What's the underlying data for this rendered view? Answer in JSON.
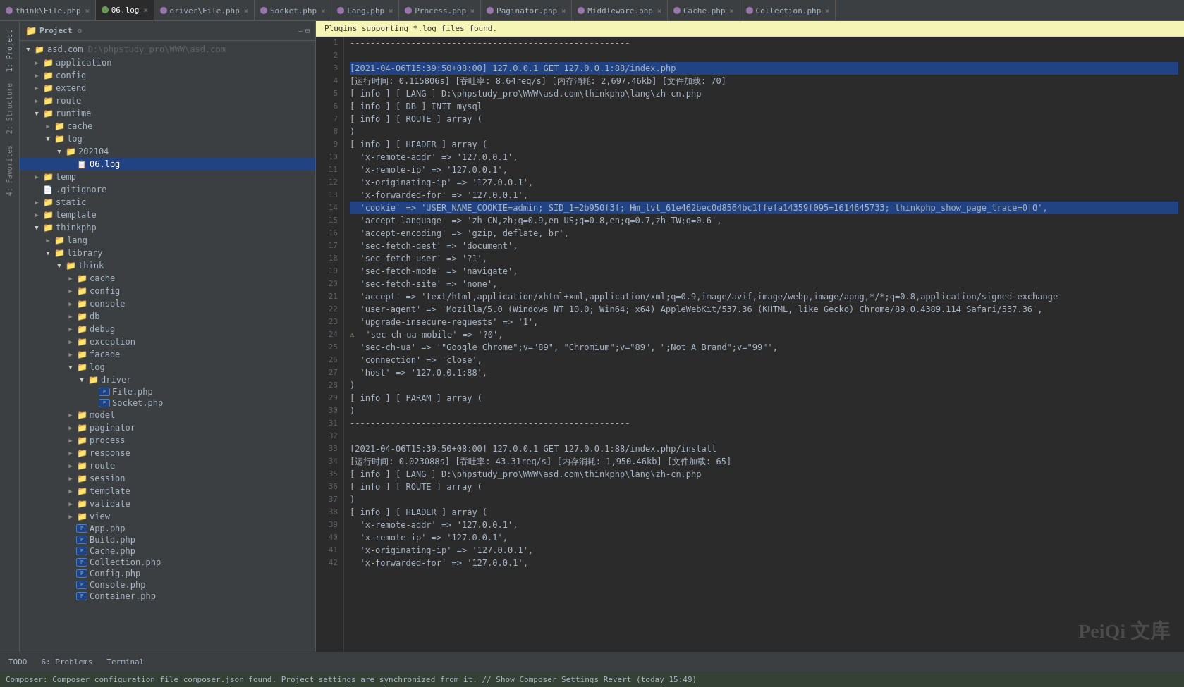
{
  "tabs": [
    {
      "id": "think-file",
      "label": "think\\File.php",
      "icon_color": "#9876aa",
      "active": false,
      "closeable": true
    },
    {
      "id": "06-log",
      "label": "06.log",
      "icon_color": "#6a9955",
      "active": true,
      "closeable": true
    },
    {
      "id": "driver-file",
      "label": "driver\\File.php",
      "icon_color": "#9876aa",
      "active": false,
      "closeable": true
    },
    {
      "id": "socket",
      "label": "Socket.php",
      "icon_color": "#9876aa",
      "active": false,
      "closeable": true
    },
    {
      "id": "lang",
      "label": "Lang.php",
      "icon_color": "#9876aa",
      "active": false,
      "closeable": true
    },
    {
      "id": "process",
      "label": "Process.php",
      "icon_color": "#9876aa",
      "active": false,
      "closeable": true
    },
    {
      "id": "paginator",
      "label": "Paginator.php",
      "icon_color": "#9876aa",
      "active": false,
      "closeable": true
    },
    {
      "id": "middleware",
      "label": "Middleware.php",
      "icon_color": "#9876aa",
      "active": false,
      "closeable": true
    },
    {
      "id": "cache",
      "label": "Cache.php",
      "icon_color": "#9876aa",
      "active": false,
      "closeable": true
    },
    {
      "id": "collection",
      "label": "Collection.php",
      "icon_color": "#9876aa",
      "active": false,
      "closeable": true
    }
  ],
  "notification": "Plugins supporting *.log files found.",
  "sidebar": {
    "title": "Project",
    "root": "asd.com",
    "root_path": "D:\\phpstudy_pro\\WWW\\asd.com",
    "items": [
      {
        "label": "application",
        "type": "folder",
        "depth": 1,
        "open": false
      },
      {
        "label": "config",
        "type": "folder",
        "depth": 1,
        "open": false
      },
      {
        "label": "extend",
        "type": "folder",
        "depth": 1,
        "open": false
      },
      {
        "label": "route",
        "type": "folder",
        "depth": 1,
        "open": false
      },
      {
        "label": "runtime",
        "type": "folder",
        "depth": 1,
        "open": true
      },
      {
        "label": "cache",
        "type": "folder",
        "depth": 2,
        "open": false
      },
      {
        "label": "log",
        "type": "folder",
        "depth": 2,
        "open": true
      },
      {
        "label": "202104",
        "type": "folder",
        "depth": 3,
        "open": true
      },
      {
        "label": "06.log",
        "type": "file-log",
        "depth": 4,
        "open": false,
        "selected": true
      },
      {
        "label": "temp",
        "type": "folder",
        "depth": 1,
        "open": false
      },
      {
        "label": ".gitignore",
        "type": "file",
        "depth": 1,
        "open": false
      },
      {
        "label": "static",
        "type": "folder",
        "depth": 1,
        "open": false
      },
      {
        "label": "template",
        "type": "folder",
        "depth": 1,
        "open": false
      },
      {
        "label": "thinkphp",
        "type": "folder",
        "depth": 1,
        "open": true
      },
      {
        "label": "lang",
        "type": "folder",
        "depth": 2,
        "open": false
      },
      {
        "label": "library",
        "type": "folder",
        "depth": 2,
        "open": true
      },
      {
        "label": "think",
        "type": "folder",
        "depth": 3,
        "open": true
      },
      {
        "label": "cache",
        "type": "folder",
        "depth": 4,
        "open": false
      },
      {
        "label": "config",
        "type": "folder",
        "depth": 4,
        "open": false
      },
      {
        "label": "console",
        "type": "folder",
        "depth": 4,
        "open": false
      },
      {
        "label": "db",
        "type": "folder",
        "depth": 4,
        "open": false
      },
      {
        "label": "debug",
        "type": "folder",
        "depth": 4,
        "open": false
      },
      {
        "label": "exception",
        "type": "folder",
        "depth": 4,
        "open": false
      },
      {
        "label": "facade",
        "type": "folder",
        "depth": 4,
        "open": false
      },
      {
        "label": "log",
        "type": "folder",
        "depth": 4,
        "open": true
      },
      {
        "label": "driver",
        "type": "folder",
        "depth": 5,
        "open": true
      },
      {
        "label": "File.php",
        "type": "file-php",
        "depth": 6,
        "open": false
      },
      {
        "label": "Socket.php",
        "type": "file-php",
        "depth": 6,
        "open": false
      },
      {
        "label": "model",
        "type": "folder",
        "depth": 4,
        "open": false
      },
      {
        "label": "paginator",
        "type": "folder",
        "depth": 4,
        "open": false
      },
      {
        "label": "process",
        "type": "folder",
        "depth": 4,
        "open": false
      },
      {
        "label": "response",
        "type": "folder",
        "depth": 4,
        "open": false
      },
      {
        "label": "route",
        "type": "folder",
        "depth": 4,
        "open": false
      },
      {
        "label": "session",
        "type": "folder",
        "depth": 4,
        "open": false
      },
      {
        "label": "template",
        "type": "folder",
        "depth": 4,
        "open": false
      },
      {
        "label": "validate",
        "type": "folder",
        "depth": 4,
        "open": false
      },
      {
        "label": "view",
        "type": "folder",
        "depth": 4,
        "open": false
      },
      {
        "label": "App.php",
        "type": "file-php",
        "depth": 4,
        "open": false
      },
      {
        "label": "Build.php",
        "type": "file-php",
        "depth": 4,
        "open": false
      },
      {
        "label": "Cache.php",
        "type": "file-php",
        "depth": 4,
        "open": false
      },
      {
        "label": "Collection.php",
        "type": "file-php",
        "depth": 4,
        "open": false
      },
      {
        "label": "Config.php",
        "type": "file-php",
        "depth": 4,
        "open": false
      },
      {
        "label": "Console.php",
        "type": "file-php",
        "depth": 4,
        "open": false
      },
      {
        "label": "Container.php",
        "type": "file-php",
        "depth": 4,
        "open": false
      }
    ]
  },
  "left_tabs": [
    {
      "label": "1: Project",
      "active": true
    },
    {
      "label": "2: Structure",
      "active": false
    },
    {
      "label": "4: Favorites",
      "active": false
    }
  ],
  "code_lines": [
    {
      "num": 1,
      "text": "-------------------------------------------------------",
      "highlighted": false
    },
    {
      "num": 2,
      "text": "",
      "highlighted": false
    },
    {
      "num": 3,
      "text": "[2021-04-06T15:39:50+08:00] 127.0.0.1 GET 127.0.0.1:88/index.php",
      "highlighted": true
    },
    {
      "num": 4,
      "text": "[运行时间: 0.115806s] [吞吐率: 8.64req/s] [内存消耗: 2,697.46kb] [文件加载: 70]",
      "highlighted": false
    },
    {
      "num": 5,
      "text": "[ info ] [ LANG ] D:\\phpstudy_pro\\WWW\\asd.com\\thinkphp\\lang\\zh-cn.php",
      "highlighted": false
    },
    {
      "num": 6,
      "text": "[ info ] [ DB ] INIT mysql",
      "highlighted": false
    },
    {
      "num": 7,
      "text": "[ info ] [ ROUTE ] array (",
      "highlighted": false
    },
    {
      "num": 8,
      "text": ")",
      "highlighted": false
    },
    {
      "num": 9,
      "text": "[ info ] [ HEADER ] array (",
      "highlighted": false
    },
    {
      "num": 10,
      "text": "  'x-remote-addr' => '127.0.0.1',",
      "highlighted": false
    },
    {
      "num": 11,
      "text": "  'x-remote-ip' => '127.0.0.1',",
      "highlighted": false
    },
    {
      "num": 12,
      "text": "  'x-originating-ip' => '127.0.0.1',",
      "highlighted": false
    },
    {
      "num": 13,
      "text": "  'x-forwarded-for' => '127.0.0.1',",
      "highlighted": false
    },
    {
      "num": 14,
      "text": "  'cookie' => 'USER_NAME_COOKIE=admin; SID_1=2b950f3f; Hm_lvt_61e462bec0d8564bc1ffefa14359f095=1614645733; thinkphp_show_page_trace=0|0',",
      "highlighted": true
    },
    {
      "num": 15,
      "text": "  'accept-language' => 'zh-CN,zh;q=0.9,en-US;q=0.8,en;q=0.7,zh-TW;q=0.6',",
      "highlighted": false
    },
    {
      "num": 16,
      "text": "  'accept-encoding' => 'gzip, deflate, br',",
      "highlighted": false
    },
    {
      "num": 17,
      "text": "  'sec-fetch-dest' => 'document',",
      "highlighted": false
    },
    {
      "num": 18,
      "text": "  'sec-fetch-user' => '?1',",
      "highlighted": false
    },
    {
      "num": 19,
      "text": "  'sec-fetch-mode' => 'navigate',",
      "highlighted": false
    },
    {
      "num": 20,
      "text": "  'sec-fetch-site' => 'none',",
      "highlighted": false
    },
    {
      "num": 21,
      "text": "  'accept' => 'text/html,application/xhtml+xml,application/xml;q=0.9,image/avif,image/webp,image/apng,*/*;q=0.8,application/signed-exchange",
      "highlighted": false
    },
    {
      "num": 22,
      "text": "  'user-agent' => 'Mozilla/5.0 (Windows NT 10.0; Win64; x64) AppleWebKit/537.36 (KHTML, like Gecko) Chrome/89.0.4389.114 Safari/537.36',",
      "highlighted": false
    },
    {
      "num": 23,
      "text": "  'upgrade-insecure-requests' => '1',",
      "highlighted": false
    },
    {
      "num": 24,
      "text": "  'sec-ch-ua-mobile' => '?0',",
      "highlighted": false,
      "has_dot": true
    },
    {
      "num": 25,
      "text": "  'sec-ch-ua' => '\"Google Chrome\";v=\"89\", \"Chromium\";v=\"89\", \";Not A Brand\";v=\"99\"',",
      "highlighted": false
    },
    {
      "num": 26,
      "text": "  'connection' => 'close',",
      "highlighted": false
    },
    {
      "num": 27,
      "text": "  'host' => '127.0.0.1:88',",
      "highlighted": false
    },
    {
      "num": 28,
      "text": ")",
      "highlighted": false
    },
    {
      "num": 29,
      "text": "[ info ] [ PARAM ] array (",
      "highlighted": false
    },
    {
      "num": 30,
      "text": ")",
      "highlighted": false
    },
    {
      "num": 31,
      "text": "-------------------------------------------------------",
      "highlighted": false
    },
    {
      "num": 32,
      "text": "",
      "highlighted": false
    },
    {
      "num": 33,
      "text": "[2021-04-06T15:39:50+08:00] 127.0.0.1 GET 127.0.0.1:88/index.php/install",
      "highlighted": false
    },
    {
      "num": 34,
      "text": "[运行时间: 0.023088s] [吞吐率: 43.31req/s] [内存消耗: 1,950.46kb] [文件加载: 65]",
      "highlighted": false
    },
    {
      "num": 35,
      "text": "[ info ] [ LANG ] D:\\phpstudy_pro\\WWW\\asd.com\\thinkphp\\lang\\zh-cn.php",
      "highlighted": false
    },
    {
      "num": 36,
      "text": "[ info ] [ ROUTE ] array (",
      "highlighted": false
    },
    {
      "num": 37,
      "text": ")",
      "highlighted": false
    },
    {
      "num": 38,
      "text": "[ info ] [ HEADER ] array (",
      "highlighted": false
    },
    {
      "num": 39,
      "text": "  'x-remote-addr' => '127.0.0.1',",
      "highlighted": false
    },
    {
      "num": 40,
      "text": "  'x-remote-ip' => '127.0.0.1',",
      "highlighted": false
    },
    {
      "num": 41,
      "text": "  'x-originating-ip' => '127.0.0.1',",
      "highlighted": false
    },
    {
      "num": 42,
      "text": "  'x-forwarded-for' => '127.0.0.1',",
      "highlighted": false
    }
  ],
  "bottom_tabs": [
    {
      "label": "TODO",
      "active": false
    },
    {
      "label": "6: Problems",
      "active": false
    },
    {
      "label": "Terminal",
      "active": false
    }
  ],
  "status_bar_text": "Composer: Composer configuration file composer.json found. Project settings are synchronized from it. // Show Composer Settings   Revert (today 15:49)",
  "watermark": "PeiQi 文库"
}
